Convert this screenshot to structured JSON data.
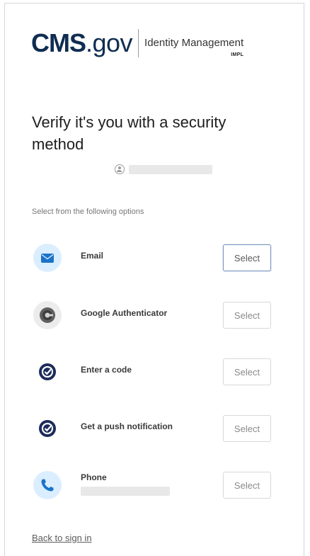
{
  "branding": {
    "cms": "CMS",
    "gov": ".gov",
    "product": "Identity Management",
    "env": "IMPL"
  },
  "title": "Verify it's you with a security method",
  "subtitle": "Select from the following options",
  "options": [
    {
      "label": "Email",
      "button": "Select",
      "icon": "envelope-icon"
    },
    {
      "label": "Google Authenticator",
      "button": "Select",
      "icon": "google-authenticator-icon"
    },
    {
      "label": "Enter a code",
      "button": "Select",
      "icon": "okta-verify-icon"
    },
    {
      "label": "Get a push notification",
      "button": "Select",
      "icon": "okta-verify-icon"
    },
    {
      "label": "Phone",
      "button": "Select",
      "icon": "phone-icon"
    }
  ],
  "back_link": "Back to sign in",
  "colors": {
    "brand_navy": "#0f2d52",
    "icon_blue": "#1a73c9",
    "icon_bg_blue": "#dbeeff"
  }
}
